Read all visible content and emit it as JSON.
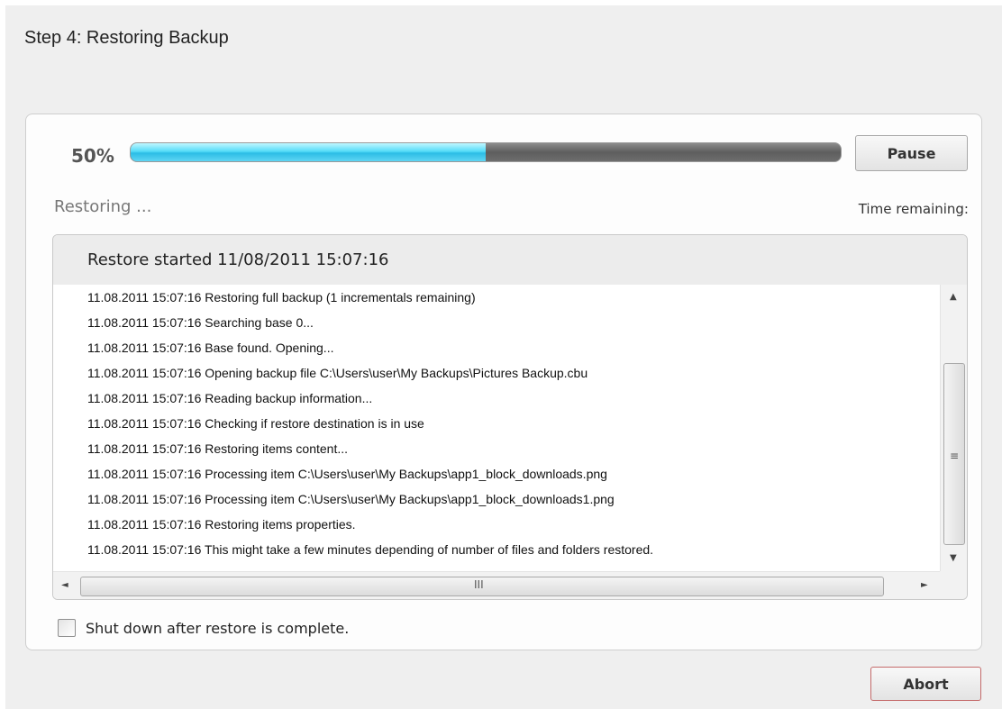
{
  "window": {
    "title": "Step 4: Restoring Backup"
  },
  "progress": {
    "percent_label": "50%",
    "value": 0.5,
    "pause_label": "Pause"
  },
  "status": {
    "text": "Restoring ...",
    "time_remaining_label": "Time remaining:"
  },
  "log": {
    "header": "Restore started 11/08/2011 15:07:16",
    "lines": [
      "11.08.2011 15:07:16 Restoring full backup (1 incrementals remaining)",
      "11.08.2011 15:07:16 Searching base 0...",
      "11.08.2011 15:07:16 Base found. Opening...",
      "11.08.2011 15:07:16 Opening backup file C:\\Users\\user\\My Backups\\Pictures Backup.cbu",
      "11.08.2011 15:07:16 Reading backup information...",
      "11.08.2011 15:07:16 Checking if restore destination is in use",
      "11.08.2011 15:07:16 Restoring items content...",
      "11.08.2011 15:07:16 Processing item C:\\Users\\user\\My Backups\\app1_block_downloads.png",
      "11.08.2011 15:07:16 Processing item C:\\Users\\user\\My Backups\\app1_block_downloads1.png",
      "11.08.2011 15:07:16 Restoring items properties.",
      "11.08.2011 15:07:16 This might take a few minutes depending of number of files and folders restored."
    ]
  },
  "options": {
    "shutdown_label": "Shut down after restore is complete.",
    "shutdown_checked": false
  },
  "footer": {
    "abort_label": "Abort"
  },
  "icons": {
    "scroll_up": "▲",
    "scroll_down": "▼",
    "scroll_left": "◄",
    "scroll_right": "►",
    "grip_vertical": "≡",
    "grip_horizontal": "III"
  },
  "colors": {
    "progress_fill": "#55dcf8",
    "abort_border": "#c46a6a"
  }
}
